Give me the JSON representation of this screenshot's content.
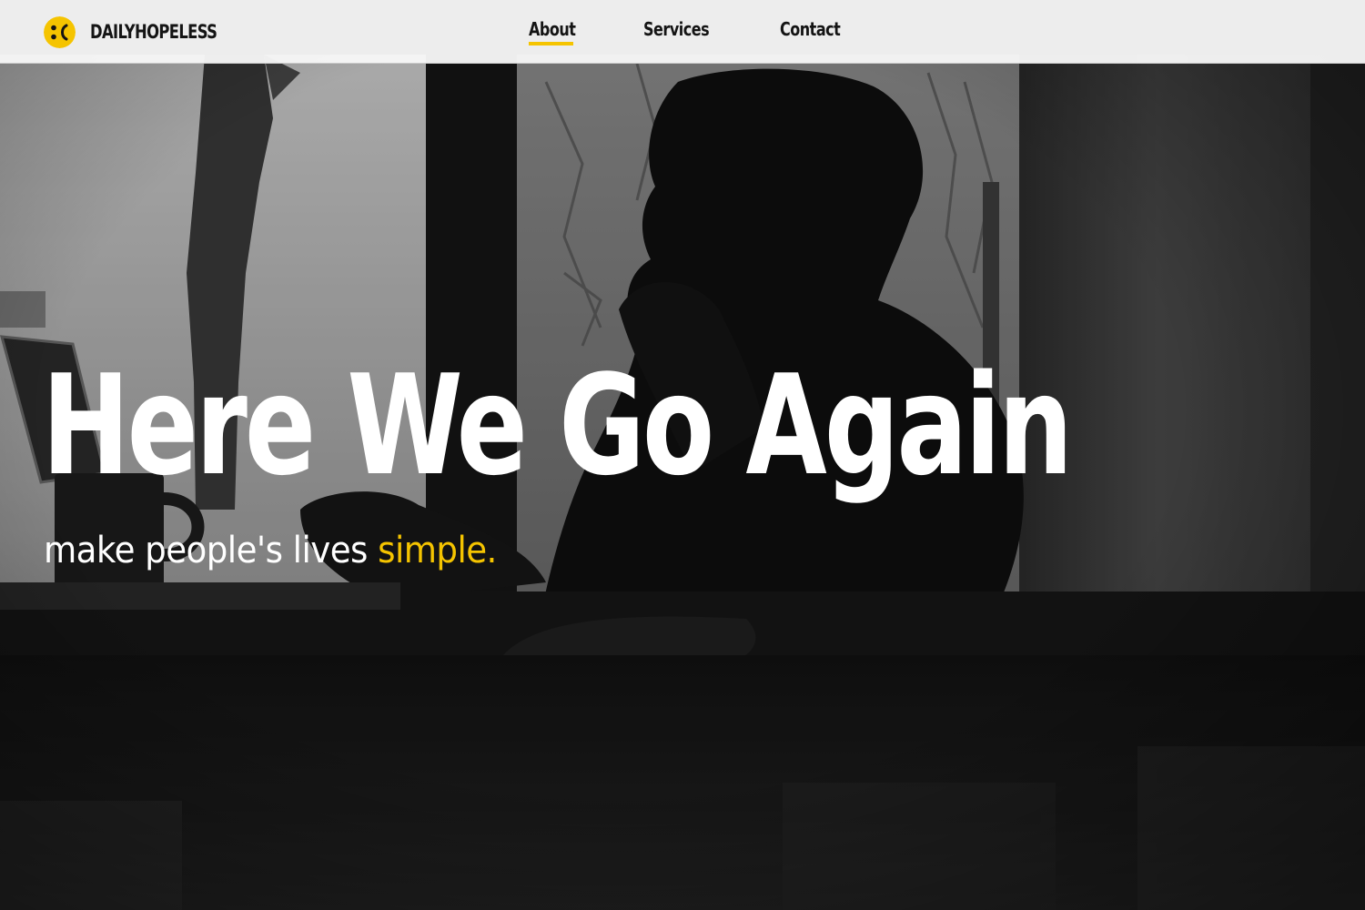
{
  "brand": {
    "name": "DAILYHOPELESS",
    "logo_icon": "sad-face-icon",
    "accent_color": "#f5c400"
  },
  "nav": {
    "items": [
      {
        "label": "About",
        "active": true
      },
      {
        "label": "Services",
        "active": false
      },
      {
        "label": "Contact",
        "active": false
      }
    ]
  },
  "hero": {
    "title": "Here We Go Again",
    "subtitle_main": "make people's lives ",
    "subtitle_accent": "simple.",
    "background": "grayscale-photo-person-at-cafe-window",
    "text_color": "#ffffff"
  }
}
